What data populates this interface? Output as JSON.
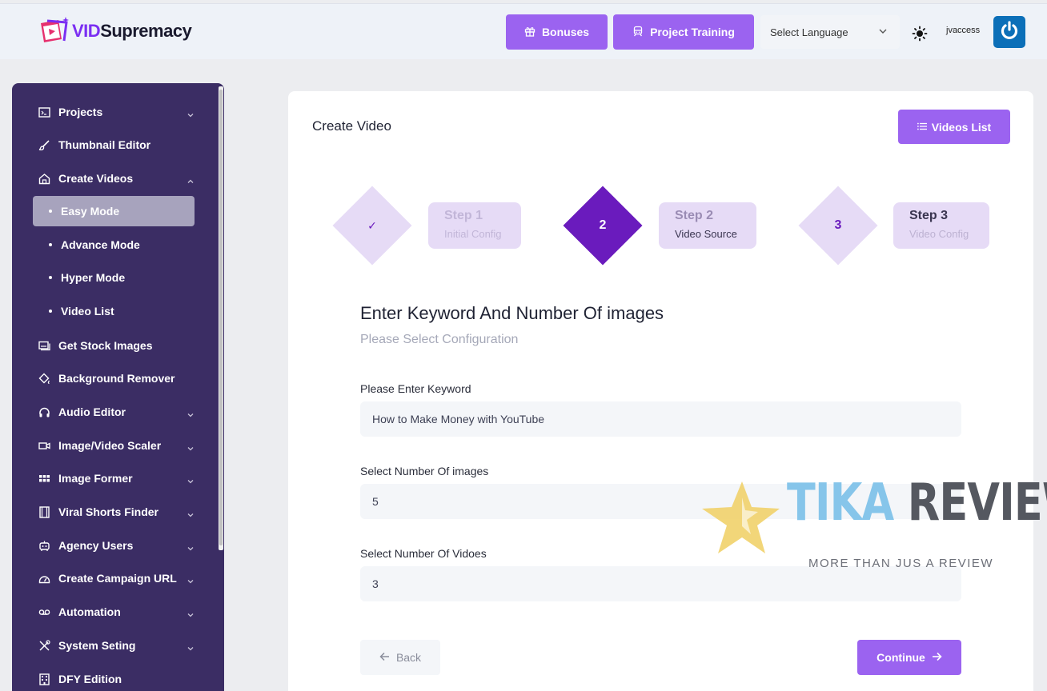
{
  "header": {
    "logo": {
      "part1": "VID",
      "part2": "Supremacy"
    },
    "bonuses_label": "Bonuses",
    "training_label": "Project Training",
    "language_select": "Select Language",
    "username": "jvaccess"
  },
  "sidebar": {
    "items": [
      {
        "label": "Projects",
        "icon": "terminal-icon",
        "chevron": "down"
      },
      {
        "label": "Thumbnail Editor",
        "icon": "brush-icon"
      },
      {
        "label": "Create Videos",
        "icon": "home-icon",
        "chevron": "up"
      },
      {
        "label": "Get Stock Images",
        "icon": "images-icon"
      },
      {
        "label": "Background Remover",
        "icon": "paint-bucket-icon"
      },
      {
        "label": "Audio Editor",
        "icon": "headphones-icon",
        "chevron": "down"
      },
      {
        "label": "Image/Video Scaler",
        "icon": "video-camera-icon",
        "chevron": "down"
      },
      {
        "label": "Image Former",
        "icon": "grid-icon",
        "chevron": "down"
      },
      {
        "label": "Viral Shorts Finder",
        "icon": "film-icon",
        "chevron": "down"
      },
      {
        "label": "Agency Users",
        "icon": "robot-icon",
        "chevron": "down"
      },
      {
        "label": "Create Campaign URL",
        "icon": "dashboard-icon",
        "chevron": "down"
      },
      {
        "label": "Automation",
        "icon": "voicemail-icon",
        "chevron": "down"
      },
      {
        "label": "System Seting",
        "icon": "tools-icon",
        "chevron": "down"
      },
      {
        "label": "DFY Edition",
        "icon": "building-icon"
      }
    ],
    "subitems": [
      {
        "label": "Easy Mode",
        "active": true
      },
      {
        "label": "Advance Mode"
      },
      {
        "label": "Hyper Mode"
      },
      {
        "label": "Video List"
      }
    ]
  },
  "main": {
    "title": "Create Video",
    "videos_list_label": "Videos List",
    "steps": [
      {
        "marker": "✓",
        "title": "Step 1",
        "subtitle": "Initial Config",
        "state": "done"
      },
      {
        "marker": "2",
        "title": "Step 2",
        "subtitle": "Video Source",
        "state": "active"
      },
      {
        "marker": "3",
        "title": "Step 3",
        "subtitle": "Video Config",
        "state": "pending"
      }
    ],
    "section_title": "Enter Keyword And Number Of images",
    "section_subtitle": "Please Select Configuration",
    "fields": [
      {
        "label": "Please Enter Keyword",
        "value": "How to Make Money with YouTube"
      },
      {
        "label": "Select Number Of images",
        "value": "5"
      },
      {
        "label": "Select Number Of Vidoes",
        "value": "3"
      }
    ],
    "back_label": "Back",
    "continue_label": "Continue"
  },
  "watermark": {
    "word1": "TIKA",
    "word2": "REVIEW",
    "tagline": "MORE THAN JUS A REVIEW"
  },
  "colors": {
    "accent": "#9b63f0",
    "sidebar": "#3b2d64",
    "step_active": "#6a1bbd",
    "step_light": "#e6dbf6"
  }
}
